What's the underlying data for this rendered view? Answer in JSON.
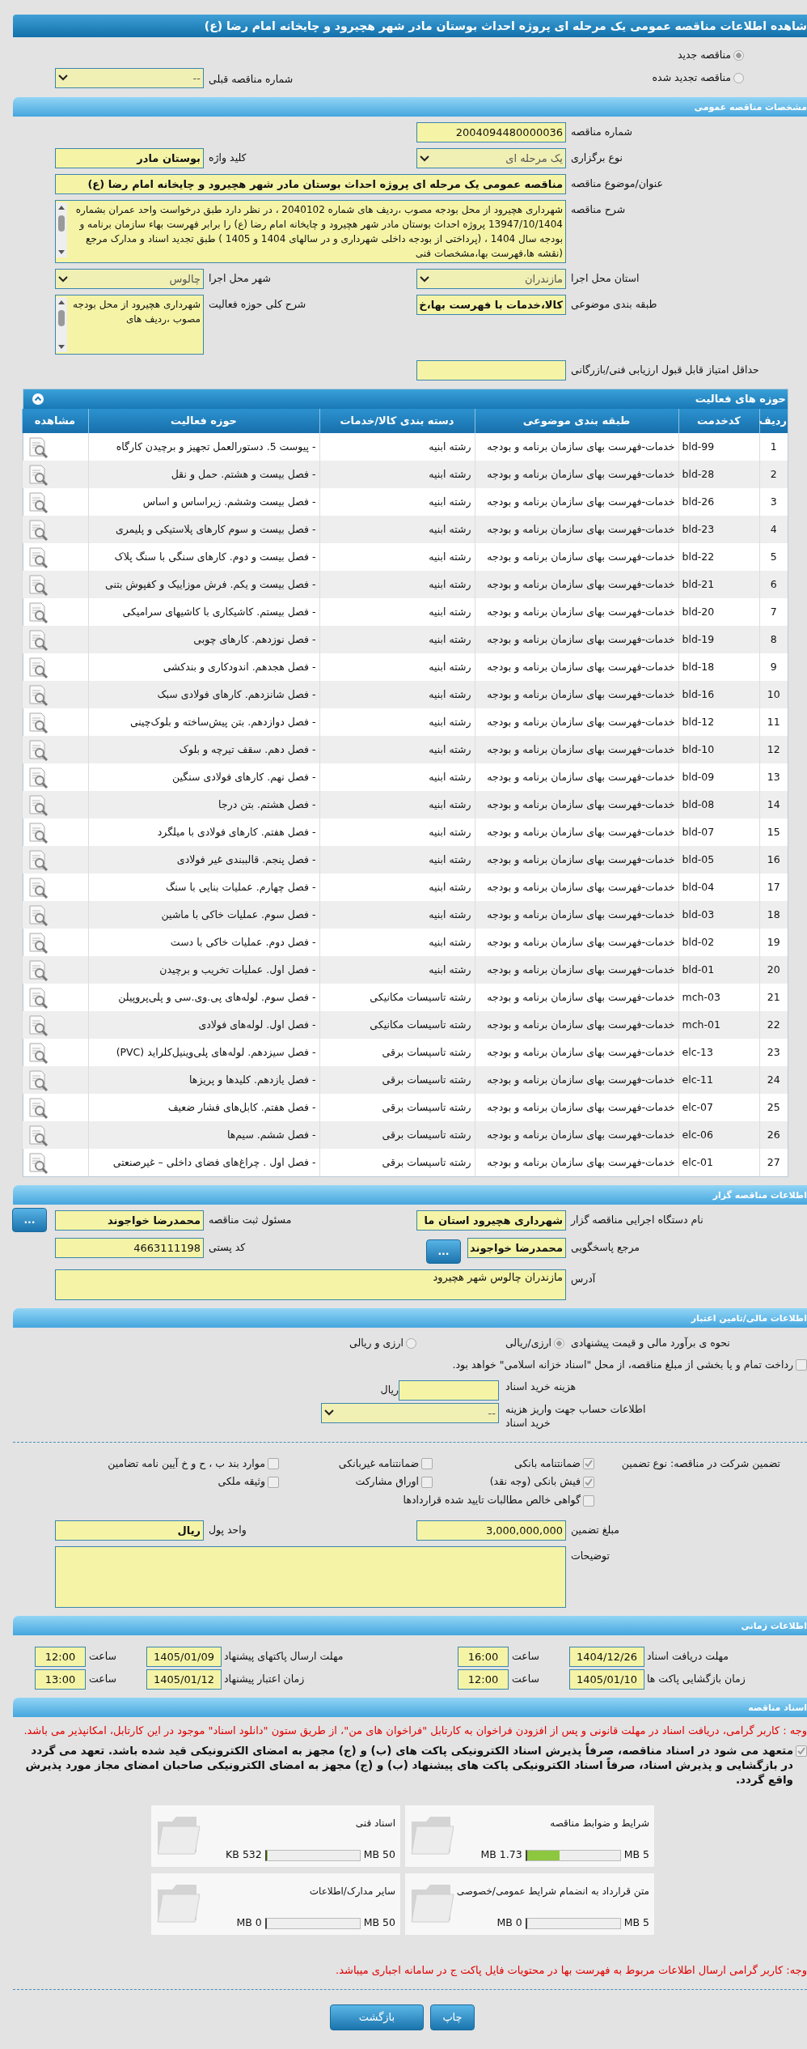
{
  "title": "شاهده اطلاعات مناقصه عمومی یک مرحله ای پروژه احداث بوستان مادر شهر هچیرود و چایخانه امام رضا (ع)",
  "tender_kind": [
    {
      "label": "مناقصه جدید",
      "selected": true
    },
    {
      "label": "مناقصه تجدید شده",
      "selected": false
    }
  ],
  "previous_tender": {
    "label": "شماره مناقصه قبلی",
    "value": "--"
  },
  "general": {
    "header": "مشخصات مناقصه عمومی",
    "rows": [
      {
        "kind": "split",
        "cells": [
          {
            "label": "شماره مناقصه",
            "kind": "text",
            "value": "2004094480000036"
          }
        ]
      },
      {
        "kind": "split",
        "cells": [
          {
            "label": "نوع برگزاری",
            "kind": "select",
            "value": "یک مرحله ای"
          },
          {
            "label": "کلید واژه",
            "kind": "strong",
            "value": "بوستان مادر"
          }
        ]
      },
      {
        "kind": "wide",
        "cells": [
          {
            "label": "عنوان/موضوع مناقصه",
            "kind": "strong",
            "value": "مناقصه عمومی یک مرحله ای پروژه احداث بوستان مادر شهر هچیرود و چایخانه امام رضا (ع)"
          }
        ]
      },
      {
        "kind": "wide",
        "cells": [
          {
            "label": "شرح مناقصه",
            "kind": "memo",
            "value": "شهرداری هچیرود از محل بودجه مصوب ،ردیف های شماره 2040102 ، در نظر دارد طبق درخواست واحد عمران بشماره 13947/10/1404 پروژه احداث بوستان مادر شهر هچیرود و چایخانه امام رضا (ع) را برابر فهرست بهاء سازمان برنامه و بودجه سال 1404 ، (پرداختی از بودجه داخلی شهرداری و در سالهای 1404 و 1405 ) طبق تجدید اسناد و مدارک مرجع (نقشه ها،فهرست بها،مشخصات فنی"
          }
        ]
      },
      {
        "kind": "split",
        "cells": [
          {
            "label": "استان محل اجرا",
            "kind": "select",
            "value": "مازندران"
          },
          {
            "label": "شهر محل اجرا",
            "kind": "select",
            "value": "چالوس"
          }
        ]
      },
      {
        "kind": "split",
        "cells": [
          {
            "label": "طبقه بندی موضوعی",
            "kind": "strong",
            "value": "کالا،خدمات با فهرست بها،خ"
          },
          {
            "label": "شرح کلی حوزه فعالیت",
            "kind": "memo",
            "value": "شهرداری هچیرود از محل بودجه مصوب ،ردیف های"
          }
        ]
      },
      {
        "kind": "split",
        "cells": [
          {
            "label": "حداقل امتیاز قابل قبول ارزیابی فنی/بازرگانی",
            "kind": "text"
          }
        ]
      }
    ]
  },
  "activities": {
    "header": "حوزه های فعالیت",
    "columns": [
      "ردیف",
      "کدخدمت",
      "طبقه بندی موضوعی",
      "دسته بندی کالا/خدمات",
      "حوزه فعالیت",
      "مشاهده"
    ],
    "rows": [
      {
        "row": "1",
        "code": "bld-99",
        "category": "خدمات-فهرست بهای سازمان برنامه و بودجه",
        "group": "رشته ابنیه",
        "activity": "- پیوست 5. دستورالعمل تجهیز و برچیدن کارگاه"
      },
      {
        "row": "2",
        "code": "bld-28",
        "category": "خدمات-فهرست بهای سازمان برنامه و بودجه",
        "group": "رشته ابنیه",
        "activity": "- فصل بیست و هشتم. حمل و نقل"
      },
      {
        "row": "3",
        "code": "bld-26",
        "category": "خدمات-فهرست بهای سازمان برنامه و بودجه",
        "group": "رشته ابنیه",
        "activity": "- فصل بیست وششم. زیراساس و اساس"
      },
      {
        "row": "4",
        "code": "bld-23",
        "category": "خدمات-فهرست بهای سازمان برنامه و بودجه",
        "group": "رشته ابنیه",
        "activity": "- فصل بیست و سوم کارهای پلاستیکی و پلیمری"
      },
      {
        "row": "5",
        "code": "bld-22",
        "category": "خدمات-فهرست بهای سازمان برنامه و بودجه",
        "group": "رشته ابنیه",
        "activity": "- فصل بیست و دوم. کارهای سنگی با سنگ پلاک"
      },
      {
        "row": "6",
        "code": "bld-21",
        "category": "خدمات-فهرست بهای سازمان برنامه و بودجه",
        "group": "رشته ابنیه",
        "activity": "- فصل بیست و یکم. فرش موزاییک و کفپوش بتنی"
      },
      {
        "row": "7",
        "code": "bld-20",
        "category": "خدمات-فهرست بهای سازمان برنامه و بودجه",
        "group": "رشته ابنیه",
        "activity": "- فصل بیستم. کاشیکاری با کاشیهای سرامیکی"
      },
      {
        "row": "8",
        "code": "bld-19",
        "category": "خدمات-فهرست بهای سازمان برنامه و بودجه",
        "group": "رشته ابنیه",
        "activity": "- فصل نوزدهم. کارهای چوبی"
      },
      {
        "row": "9",
        "code": "bld-18",
        "category": "خدمات-فهرست بهای سازمان برنامه و بودجه",
        "group": "رشته ابنیه",
        "activity": "- فصل هجدهم. اندودکاری و بندکشی"
      },
      {
        "row": "10",
        "code": "bld-16",
        "category": "خدمات-فهرست بهای سازمان برنامه و بودجه",
        "group": "رشته ابنیه",
        "activity": "- فصل شانزدهم. کارهای فولادی سبک"
      },
      {
        "row": "11",
        "code": "bld-12",
        "category": "خدمات-فهرست بهای سازمان برنامه و بودجه",
        "group": "رشته ابنیه",
        "activity": "- فصل دوازدهم. بتن پیش‌ساخته و بلوک‌چینی"
      },
      {
        "row": "12",
        "code": "bld-10",
        "category": "خدمات-فهرست بهای سازمان برنامه و بودجه",
        "group": "رشته ابنیه",
        "activity": "- فصل دهم. سقف تیرچه و بلوک"
      },
      {
        "row": "13",
        "code": "bld-09",
        "category": "خدمات-فهرست بهای سازمان برنامه و بودجه",
        "group": "رشته ابنیه",
        "activity": "- فصل نهم. کارهای فولادی سنگین"
      },
      {
        "row": "14",
        "code": "bld-08",
        "category": "خدمات-فهرست بهای سازمان برنامه و بودجه",
        "group": "رشته ابنیه",
        "activity": "- فصل هشتم. بتن درجا"
      },
      {
        "row": "15",
        "code": "bld-07",
        "category": "خدمات-فهرست بهای سازمان برنامه و بودجه",
        "group": "رشته ابنیه",
        "activity": "- فصل هفتم. کارهای فولادی با میلگرد"
      },
      {
        "row": "16",
        "code": "bld-05",
        "category": "خدمات-فهرست بهای سازمان برنامه و بودجه",
        "group": "رشته ابنیه",
        "activity": "- فصل پنجم. قالببندی غیر فولادی"
      },
      {
        "row": "17",
        "code": "bld-04",
        "category": "خدمات-فهرست بهای سازمان برنامه و بودجه",
        "group": "رشته ابنیه",
        "activity": "- فصل چهارم. عملیات بنایی با سنگ"
      },
      {
        "row": "18",
        "code": "bld-03",
        "category": "خدمات-فهرست بهای سازمان برنامه و بودجه",
        "group": "رشته ابنیه",
        "activity": "- فصل سوم. عملیات خاکی با ماشین"
      },
      {
        "row": "19",
        "code": "bld-02",
        "category": "خدمات-فهرست بهای سازمان برنامه و بودجه",
        "group": "رشته ابنیه",
        "activity": "- فصل دوم. عملیات خاکی با دست"
      },
      {
        "row": "20",
        "code": "bld-01",
        "category": "خدمات-فهرست بهای سازمان برنامه و بودجه",
        "group": "رشته ابنیه",
        "activity": "- فصل اول. عملیات تخریب و برچیدن"
      },
      {
        "row": "21",
        "code": "mch-03",
        "category": "خدمات-فهرست بهای سازمان برنامه و بودجه",
        "group": "رشته تاسیسات مکانیکی",
        "activity": "- فصل سوم. لوله‌های پی.وی.سی و پلی‌پروپیلن"
      },
      {
        "row": "22",
        "code": "mch-01",
        "category": "خدمات-فهرست بهای سازمان برنامه و بودجه",
        "group": "رشته تاسیسات مکانیکی",
        "activity": "- فصل اول. لوله‌های فولادی"
      },
      {
        "row": "23",
        "code": "elc-13",
        "category": "خدمات-فهرست بهای سازمان برنامه و بودجه",
        "group": "رشته تاسیسات برقی",
        "activity": "- فصل سیزدهم. لوله‌های پلی‌وینیل‌کلراید (PVC)"
      },
      {
        "row": "24",
        "code": "elc-11",
        "category": "خدمات-فهرست بهای سازمان برنامه و بودجه",
        "group": "رشته تاسیسات برقی",
        "activity": "- فصل یازدهم. کلیدها و پریزها"
      },
      {
        "row": "25",
        "code": "elc-07",
        "category": "خدمات-فهرست بهای سازمان برنامه و بودجه",
        "group": "رشته تاسیسات برقی",
        "activity": "- فصل هفتم. کابل‌های فشار ضعیف"
      },
      {
        "row": "26",
        "code": "elc-06",
        "category": "خدمات-فهرست بهای سازمان برنامه و بودجه",
        "group": "رشته تاسیسات برقی",
        "activity": "- فصل ششم. سیم‌ها"
      },
      {
        "row": "27",
        "code": "elc-01",
        "category": "خدمات-فهرست بهای سازمان برنامه و بودجه",
        "group": "رشته تاسیسات برقی",
        "activity": "- فصل اول . چراغ‌های فضای داخلی – غیرصنعتی"
      }
    ]
  },
  "tenderer": {
    "header": "اطلاعات مناقصه گزار",
    "rows": [
      {
        "kind": "split",
        "cells": [
          {
            "label": "نام دستگاه اجرایی مناقصه گزار",
            "kind": "strong",
            "value": "شهرداری هچیرود استان ما"
          },
          {
            "label": "مسئول ثبت مناقصه",
            "kind": "strong",
            "value": "محمدرضا خواجوند",
            "button": "..."
          }
        ]
      },
      {
        "kind": "split",
        "cells": [
          {
            "label": "مرجع پاسخگویی",
            "kind": "strong",
            "value": "محمدرضا خواجوند",
            "button": "..."
          },
          {
            "label": "کد پستی",
            "kind": "text",
            "value": "4663111198"
          }
        ]
      },
      {
        "kind": "wide",
        "cells": [
          {
            "label": "آدرس",
            "kind": "area",
            "value": "مازندران چالوس شهر هچیرود"
          }
        ]
      }
    ]
  },
  "finance": {
    "header": "اطلاعات مالی/تامین اعتبار",
    "estimate": {
      "label": "نحوه ی برآورد مالی و قیمت پیشنهادی",
      "options": [
        {
          "label": "ارزی/ریالی",
          "selected": true
        },
        {
          "label": "ارزی و ریالی",
          "selected": false
        }
      ]
    },
    "treasury": {
      "label": "رداخت تمام و یا بخشی از مبلغ مناقصه، از محل \"اسناد خزانه اسلامی\" خواهد بود.",
      "checked": false
    },
    "doc_fee": {
      "label": "هزینه خرید اسناد",
      "unit": "ریال"
    },
    "account": {
      "label": "اطلاعات حساب جهت واریز هزینه خرید اسناد",
      "value": "--"
    },
    "guarantee": {
      "label": "تضمین شرکت در مناقصه:",
      "type_label": "نوع تضمین",
      "options": [
        {
          "label": "ضمانتنامه بانکی",
          "checked": true
        },
        {
          "label": "ضمانتنامه غیربانکی",
          "checked": false
        },
        {
          "label": "موارد بند ب ، ح و خ آیین نامه تضامین",
          "checked": false
        },
        {
          "label": "فیش بانکی (وجه نقد)",
          "checked": true
        },
        {
          "label": "اوراق مشارکت",
          "checked": false
        },
        {
          "label": "وثیقه ملکی",
          "checked": false
        },
        {
          "label": "گواهی خالص مطالبات تایید شده قراردادها",
          "checked": false
        }
      ]
    },
    "rows": [
      {
        "kind": "split",
        "cells": [
          {
            "label": "مبلغ تضمین",
            "kind": "text",
            "value": "3,000,000,000"
          },
          {
            "label": "واحد پول",
            "kind": "strong",
            "value": "ریال"
          }
        ]
      },
      {
        "kind": "wide",
        "cells": [
          {
            "label": "توضیحات",
            "kind": "area"
          }
        ]
      }
    ]
  },
  "schedule": {
    "header": "اطلاعات زمانی",
    "rows": [
      {
        "items": [
          {
            "label": "مهلت دریافت اسناد",
            "date": "1404/12/26",
            "time_label": "ساعت",
            "time": "16:00"
          },
          {
            "label": "مهلت ارسال پاکتهای پیشنهاد",
            "date": "1405/01/09",
            "time_label": "ساعت",
            "time": "12:00"
          }
        ]
      },
      {
        "items": [
          {
            "label": "زمان بازگشایی پاکت ها",
            "date": "1405/01/10",
            "time_label": "ساعت",
            "time": "12:00"
          },
          {
            "label": "زمان اعتبار پیشنهاد",
            "date": "1405/01/12",
            "time_label": "ساعت",
            "time": "13:00"
          }
        ]
      }
    ]
  },
  "documents": {
    "header": "اسناد مناقصه",
    "notice": "وجه : کاربر گرامی، دریافت اسناد در مهلت قانونی و پس از افزودن فراخوان به کارتابل \"فراخوان های من\"، از طریق ستون \"دانلود اسناد\" موجود در این کارتابل، امکانپذیر می باشد.",
    "commitment": {
      "text": "متعهد می شود در اسناد مناقصه، صرفاً پذیرش اسناد الکترونیکی پاکت های (ب) و (ج) مجهز به امضای الکترونیکی قید شده باشد. تعهد می گردد در بازگشایی و پذیرش اسناد، صرفاً اسناد الکترونیکی پاکت های پیشنهاد (ب) و (ج) مجهز به امضای الکترونیکی صاحبان امضای مجاز مورد پذیرش واقع گردد.",
      "checked": true
    },
    "files": [
      {
        "title": "شرایط و ضوابط مناقصه",
        "limit": "5 MB",
        "used": "1.73 MB",
        "level": 0.35
      },
      {
        "title": "اسناد فنی",
        "limit": "50 MB",
        "used": "532 KB",
        "level": 0.01
      },
      {
        "title": "متن قرارداد به انضمام شرایط عمومی/خصوصی",
        "limit": "5 MB",
        "used": "0 MB",
        "level": 0
      },
      {
        "title": "سایر مدارک/اطلاعات",
        "limit": "50 MB",
        "used": "0 MB",
        "level": 0
      }
    ],
    "footnote": "وجه: کاربر گرامی ارسال اطلاعات مربوط به فهرست بها در محتویات فایل پاکت ج در سامانه اجباری میباشد."
  },
  "buttons": [
    {
      "label": "چاپ"
    },
    {
      "label": "بازگشت"
    }
  ]
}
